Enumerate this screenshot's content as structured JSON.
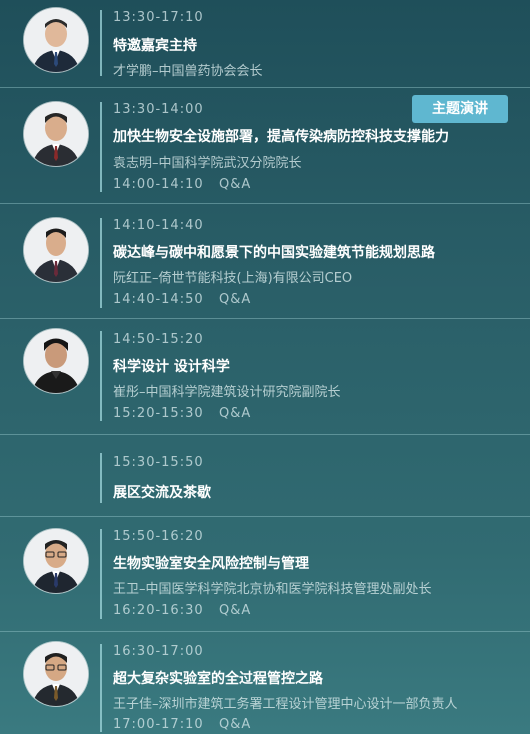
{
  "badge": "主题演讲",
  "sessions": [
    {
      "time": "13:30-17:10",
      "title": "特邀嘉宾主持",
      "speaker": "才学鹏–中国兽药协会会长"
    },
    {
      "time": "13:30-14:00",
      "title": "加快生物安全设施部署，提高传染病防控科技支撑能力",
      "speaker": "袁志明–中国科学院武汉分院院长",
      "qa_time": "14:00-14:10",
      "qa_label": "Q&A"
    },
    {
      "time": "14:10-14:40",
      "title": "碳达峰与碳中和愿景下的中国实验建筑节能规划思路",
      "speaker": "阮红正–倚世节能科技(上海)有限公司CEO",
      "qa_time": "14:40-14:50",
      "qa_label": "Q&A"
    },
    {
      "time": "14:50-15:20",
      "title": "科学设计 设计科学",
      "speaker": "崔彤–中国科学院建筑设计研究院副院长",
      "qa_time": "15:20-15:30",
      "qa_label": "Q&A"
    },
    {
      "time": "15:30-15:50",
      "title": "展区交流及茶歇"
    },
    {
      "time": "15:50-16:20",
      "title": "生物实验室安全风险控制与管理",
      "speaker": "王卫–中国医学科学院北京协和医学院科技管理处副处长",
      "qa_time": "16:20-16:30",
      "qa_label": "Q&A"
    },
    {
      "time": "16:30-17:00",
      "title": "超大复杂实验室的全过程管控之路",
      "speaker": "王子佳–深圳市建筑工务署工程设计管理中心设计一部负责人",
      "qa_time": "17:00-17:10",
      "qa_label": "Q&A"
    }
  ]
}
